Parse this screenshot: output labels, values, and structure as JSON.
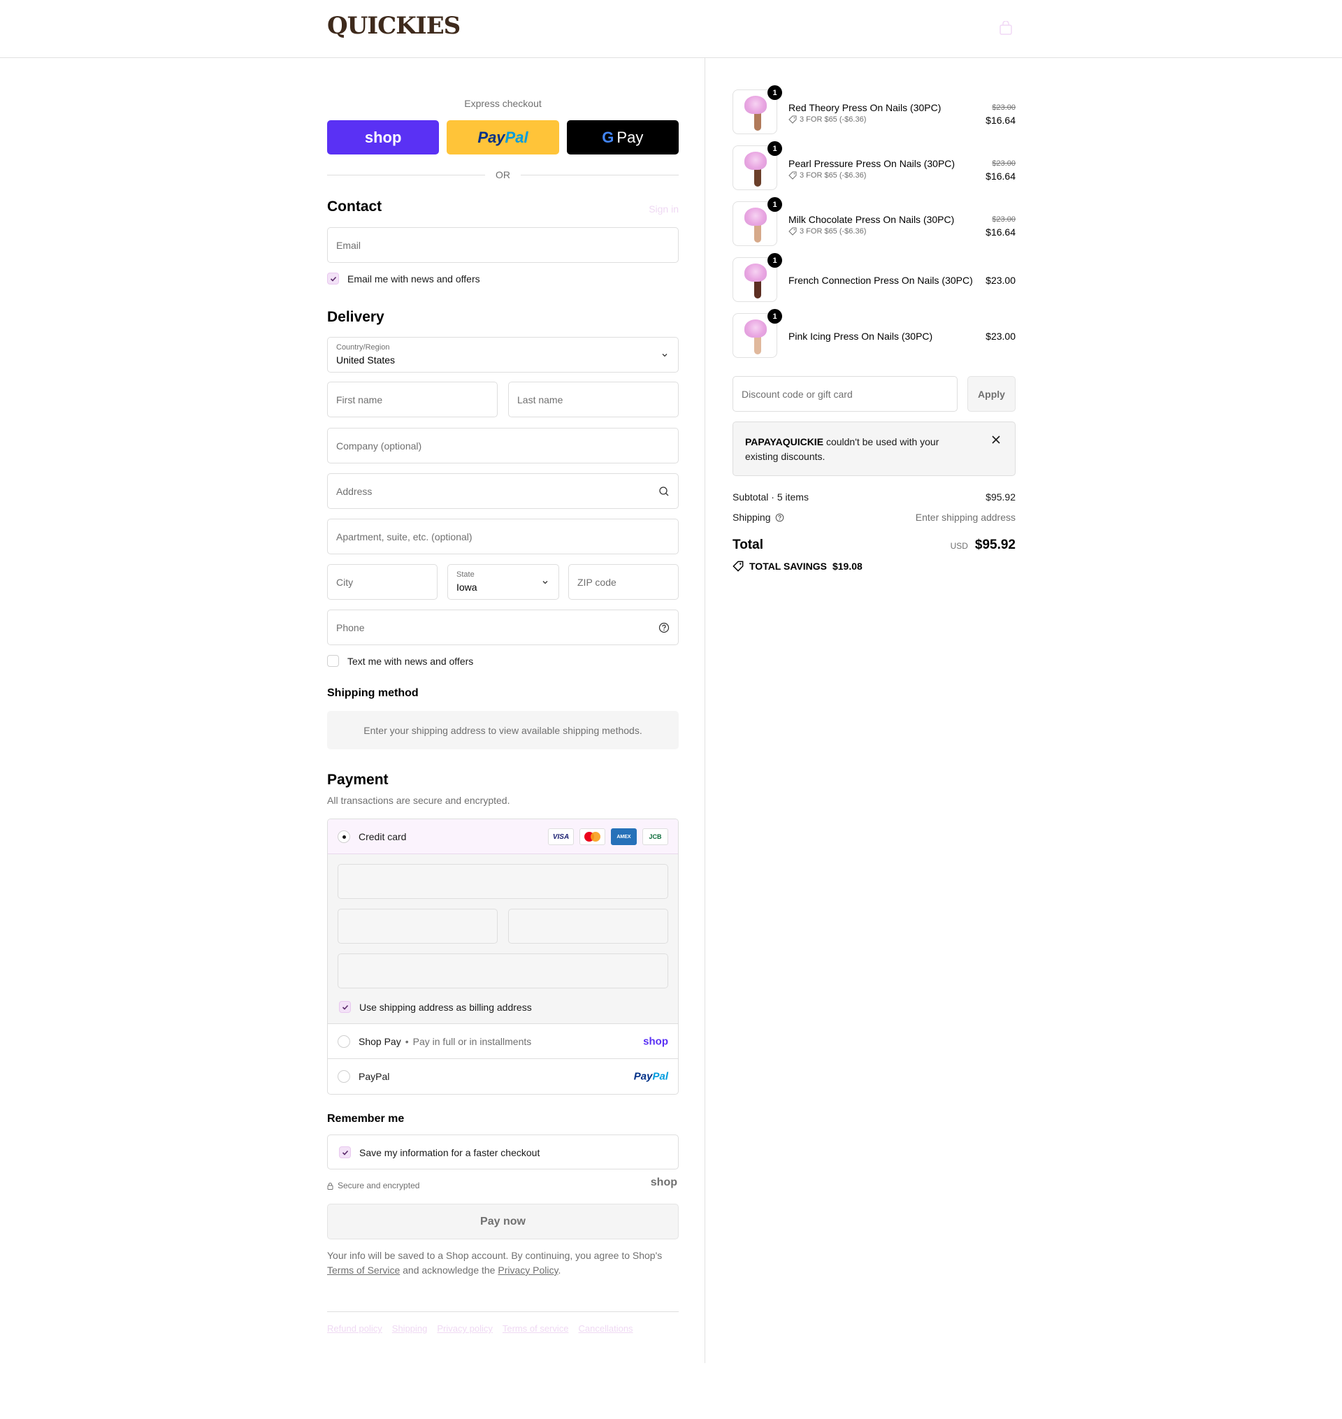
{
  "header": {
    "logo": "QUICKIES"
  },
  "express": {
    "title": "Express checkout",
    "shop_label": "shop",
    "paypal_label_1": "Pay",
    "paypal_label_2": "Pal",
    "gpay_g": "G",
    "gpay_label": "Pay",
    "or": "OR"
  },
  "contact": {
    "title": "Contact",
    "sign_in": "Sign in",
    "email_placeholder": "Email",
    "news_label": "Email me with news and offers",
    "news_checked": true
  },
  "delivery": {
    "title": "Delivery",
    "country_label": "Country/Region",
    "country_value": "United States",
    "first_name": "First name",
    "last_name": "Last name",
    "company": "Company (optional)",
    "address": "Address",
    "apartment": "Apartment, suite, etc. (optional)",
    "city": "City",
    "state_label": "State",
    "state_value": "Iowa",
    "zip": "ZIP code",
    "phone": "Phone",
    "text_label": "Text me with news and offers",
    "text_checked": false
  },
  "shipping_method": {
    "title": "Shipping method",
    "message": "Enter your shipping address to view available shipping methods."
  },
  "payment": {
    "title": "Payment",
    "subtitle": "All transactions are secure and encrypted.",
    "credit_card": "Credit card",
    "card_brands": [
      "VISA",
      "mastercard",
      "AMEX",
      "JCB"
    ],
    "billing_label": "Use shipping address as billing address",
    "shop_pay": "Shop Pay",
    "shop_pay_sub": "Pay in full or in installments",
    "shop_logo": "shop",
    "paypal": "PayPal",
    "paypal_logo_1": "Pay",
    "paypal_logo_2": "Pal",
    "selected": "Credit card"
  },
  "remember": {
    "title": "Remember me",
    "save_label": "Save my information for a faster checkout",
    "secure": "Secure and encrypted",
    "shop_logo": "shop"
  },
  "pay_now": "Pay now",
  "legal": {
    "text_1": "Your info will be saved to a Shop account. By continuing, you agree to Shop's",
    "terms": "Terms of Service",
    "text_2": "and acknowledge the",
    "privacy": "Privacy Policy",
    "text_3": "."
  },
  "footer": {
    "links": [
      "Refund policy",
      "Shipping",
      "Privacy policy",
      "Terms of service",
      "Cancellations"
    ]
  },
  "cart": {
    "items": [
      {
        "name": "Red Theory Press On Nails (30PC)",
        "qty": "1",
        "promo": "3 FOR $65 (-$6.36)",
        "original": "$23.00",
        "price": "$16.64"
      },
      {
        "name": "Pearl Pressure Press On Nails (30PC)",
        "qty": "1",
        "promo": "3 FOR $65 (-$6.36)",
        "original": "$23.00",
        "price": "$16.64"
      },
      {
        "name": "Milk Chocolate Press On Nails (30PC)",
        "qty": "1",
        "promo": "3 FOR $65 (-$6.36)",
        "original": "$23.00",
        "price": "$16.64"
      },
      {
        "name": "French Connection Press On Nails (30PC)",
        "qty": "1",
        "price": "$23.00"
      },
      {
        "name": "Pink Icing Press On Nails (30PC)",
        "qty": "1",
        "price": "$23.00"
      }
    ],
    "discount_placeholder": "Discount code or gift card",
    "apply": "Apply",
    "notice_code": "PAPAYAQUICKIE",
    "notice_text": "couldn't be used with your existing discounts.",
    "subtotal_label": "Subtotal · 5 items",
    "subtotal_value": "$95.92",
    "shipping_label": "Shipping",
    "shipping_value": "Enter shipping address",
    "total_label": "Total",
    "currency": "USD",
    "total_value": "$95.92",
    "savings_label": "TOTAL SAVINGS",
    "savings_value": "$19.08"
  },
  "colors": {
    "accent": "#5a31f4",
    "paypal_yellow": "#ffc439",
    "pink_tint": "#f3e2f7"
  }
}
